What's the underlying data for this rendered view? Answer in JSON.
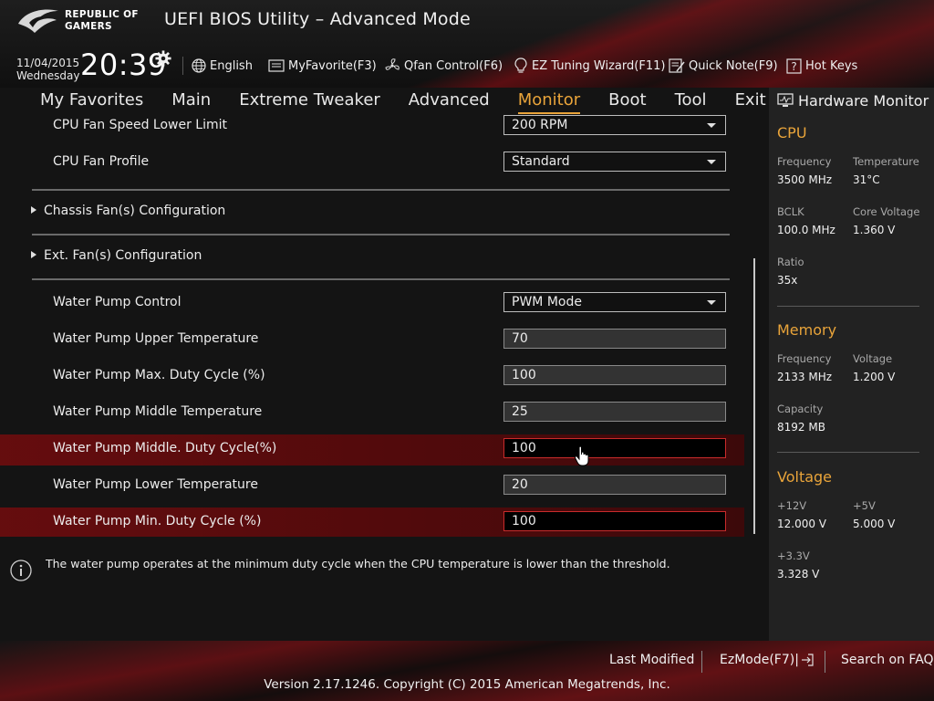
{
  "header": {
    "logo_line1": "REPUBLIC OF",
    "logo_line2": "GAMERS",
    "title": "UEFI BIOS Utility – Advanced Mode",
    "date": "11/04/2015",
    "day": "Wednesday",
    "time": "20:39"
  },
  "toolbar": {
    "language": "English",
    "myfavorite": "MyFavorite(F3)",
    "qfan": "Qfan Control(F6)",
    "ez_tuning": "EZ Tuning Wizard(F11)",
    "quick_note": "Quick Note(F9)",
    "hot_keys": "Hot Keys"
  },
  "menu": {
    "items": [
      "My Favorites",
      "Main",
      "Extreme Tweaker",
      "Advanced",
      "Monitor",
      "Boot",
      "Tool",
      "Exit"
    ],
    "active": "Monitor"
  },
  "settings": {
    "cpu_fan_speed_lower_limit": {
      "label": "CPU Fan Speed Lower Limit",
      "value": "200 RPM"
    },
    "cpu_fan_profile": {
      "label": "CPU Fan Profile",
      "value": "Standard"
    },
    "chassis_fan_config": "Chassis Fan(s) Configuration",
    "ext_fan_config": "Ext. Fan(s) Configuration",
    "water_pump_control": {
      "label": "Water Pump Control",
      "value": "PWM Mode"
    },
    "water_pump_upper_temp": {
      "label": "Water Pump Upper Temperature",
      "value": "70"
    },
    "water_pump_max_duty": {
      "label": "Water Pump Max. Duty Cycle (%)",
      "value": "100"
    },
    "water_pump_middle_temp": {
      "label": "Water Pump Middle Temperature",
      "value": "25"
    },
    "water_pump_middle_duty": {
      "label": "Water Pump Middle. Duty Cycle(%)",
      "value": "100"
    },
    "water_pump_lower_temp": {
      "label": "Water Pump Lower Temperature",
      "value": "20"
    },
    "water_pump_min_duty": {
      "label": "Water Pump Min. Duty Cycle (%)",
      "value": "100"
    }
  },
  "info": {
    "text": "The water pump operates at the minimum duty cycle when the CPU temperature is lower than the threshold."
  },
  "hardware_monitor": {
    "title": "Hardware Monitor",
    "cpu": {
      "heading": "CPU",
      "frequency_label": "Frequency",
      "frequency": "3500 MHz",
      "temperature_label": "Temperature",
      "temperature": "31°C",
      "bclk_label": "BCLK",
      "bclk": "100.0 MHz",
      "core_voltage_label": "Core Voltage",
      "core_voltage": "1.360 V",
      "ratio_label": "Ratio",
      "ratio": "35x"
    },
    "memory": {
      "heading": "Memory",
      "frequency_label": "Frequency",
      "frequency": "2133 MHz",
      "voltage_label": "Voltage",
      "voltage": "1.200 V",
      "capacity_label": "Capacity",
      "capacity": "8192 MB"
    },
    "voltage": {
      "heading": "Voltage",
      "v12_label": "+12V",
      "v12": "12.000 V",
      "v5_label": "+5V",
      "v5": "5.000 V",
      "v33_label": "+3.3V",
      "v33": "3.328 V"
    }
  },
  "footer": {
    "last_modified": "Last Modified",
    "ezmode": "EzMode(F7)|",
    "search_faq": "Search on FAQ",
    "copyright": "Version 2.17.1246. Copyright (C) 2015 American Megatrends, Inc."
  },
  "colors": {
    "accent": "#e9a43a",
    "highlight": "#7a0c10",
    "active_border": "#c92b2b"
  }
}
